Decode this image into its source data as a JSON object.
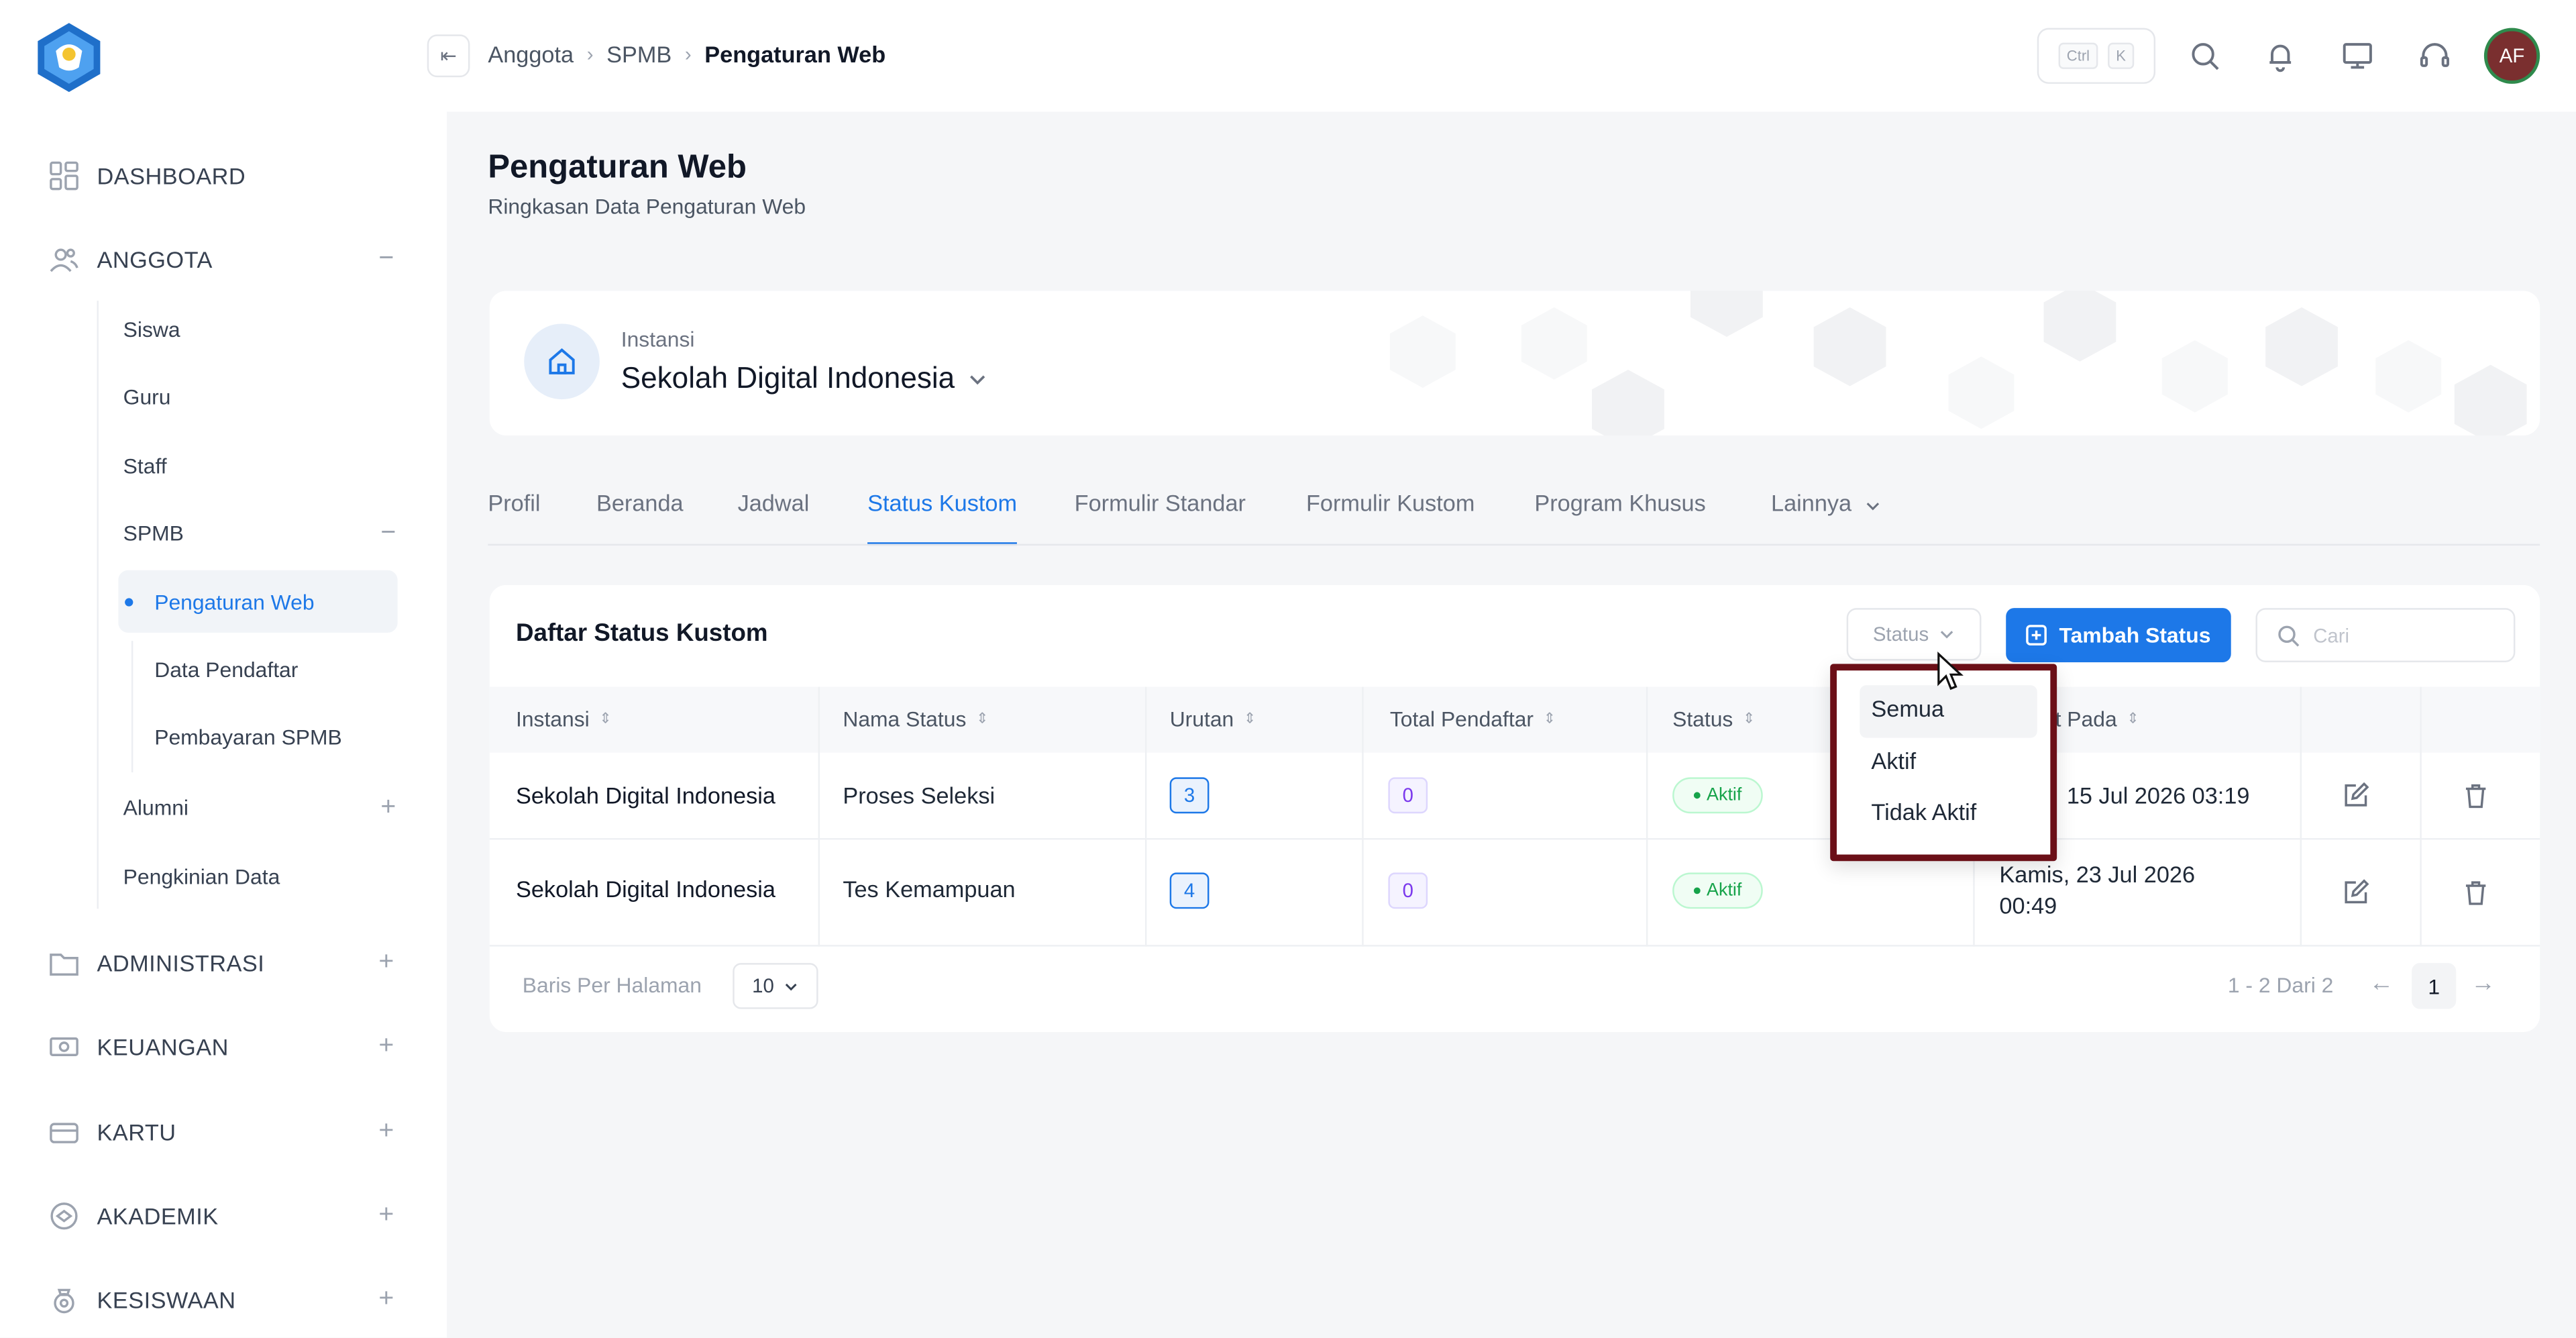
{
  "sidebar": {
    "items": [
      {
        "label": "DASHBOARD",
        "icon": "dashboard-grid-icon"
      },
      {
        "label": "ANGGOTA",
        "icon": "users-icon",
        "toggle": "−"
      },
      {
        "label": "ADMINISTRASI",
        "icon": "folder-icon",
        "toggle": "+"
      },
      {
        "label": "KEUANGAN",
        "icon": "money-icon",
        "toggle": "+"
      },
      {
        "label": "KARTU",
        "icon": "card-icon",
        "toggle": "+"
      },
      {
        "label": "AKADEMIK",
        "icon": "academic-icon",
        "toggle": "+"
      },
      {
        "label": "KESISWAAN",
        "icon": "student-icon",
        "toggle": "+"
      }
    ],
    "anggota_children": [
      "Siswa",
      "Guru",
      "Staff",
      "SPMB",
      "Alumni",
      "Pengkinian Data"
    ],
    "spmb_toggle": "−",
    "alumni_toggle": "+",
    "spmb_children": [
      "Pengaturan Web",
      "Data Pendaftar",
      "Pembayaran SPMB"
    ]
  },
  "topbar": {
    "collapse_glyph": "⇤",
    "breadcrumb": [
      "Anggota",
      "SPMB",
      "Pengaturan Web"
    ],
    "sep": "›",
    "kbd_ctrl": "Ctrl",
    "kbd_k": "K",
    "avatar_initials": "AF"
  },
  "page": {
    "title": "Pengaturan Web",
    "subtitle": "Ringkasan Data Pengaturan Web"
  },
  "instansi": {
    "label": "Instansi",
    "name": "Sekolah Digital Indonesia"
  },
  "tabs": [
    "Profil",
    "Beranda",
    "Jadwal",
    "Status Kustom",
    "Formulir Standar",
    "Formulir Kustom",
    "Program Khusus",
    "Lainnya"
  ],
  "table_card": {
    "title": "Daftar Status Kustom",
    "status_filter": "Status",
    "add_button": "Tambah Status",
    "search_placeholder": "Cari",
    "columns": [
      "Instansi",
      "Nama Status",
      "Urutan",
      "Total Pendaftar",
      "Status",
      "Dibuat Pada"
    ],
    "rows": [
      {
        "instansi": "Sekolah Digital Indonesia",
        "nama": "Proses Seleksi",
        "urutan": "3",
        "total": "0",
        "status": "Aktif",
        "dibuat": "15 Jul 2026 03:19"
      },
      {
        "instansi": "Sekolah Digital Indonesia",
        "nama": "Tes Kemampuan",
        "urutan": "4",
        "total": "0",
        "status": "Aktif",
        "dibuat_1": "Kamis, 23 Jul 2026",
        "dibuat_2": "00:49"
      }
    ],
    "rows_per_page_label": "Baris Per Halaman",
    "rows_per_page": "10",
    "range": "1 - 2 Dari 2",
    "current_page": "1",
    "prev": "←",
    "next": "→"
  },
  "status_dropdown": {
    "options": [
      "Semua",
      "Aktif",
      "Tidak Aktif"
    ]
  },
  "colors": {
    "accent": "#1d78e8",
    "highlight_border": "#6b0f17",
    "status_active": "#16a34a"
  }
}
